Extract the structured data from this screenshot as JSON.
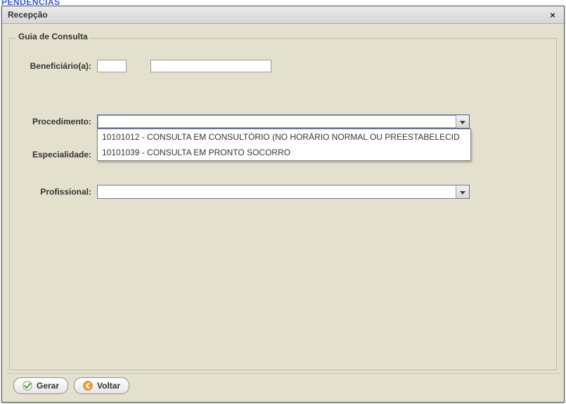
{
  "window": {
    "title": "Recepção",
    "close_title": "Fechar"
  },
  "group": {
    "title": "Guia de Consulta"
  },
  "fields": {
    "beneficiario_label": "Beneficiário(a):",
    "beneficiario_code": "",
    "beneficiario_name": "",
    "procedimento_label": "Procedimento:",
    "procedimento_value": "",
    "procedimento_options": {
      "0": "10101012 - CONSULTA EM CONSULTÓRIO (NO HORÁRIO NORMAL OU PREESTABELECID",
      "1": "10101039 - CONSULTA EM PRONTO SOCORRO"
    },
    "especialidade_label": "Especialidade:",
    "profissional_label": "Profissional:",
    "profissional_value": ""
  },
  "buttons": {
    "gerar": "Gerar",
    "voltar": "Voltar"
  },
  "bg_hint": "PENDÊNCIAS"
}
